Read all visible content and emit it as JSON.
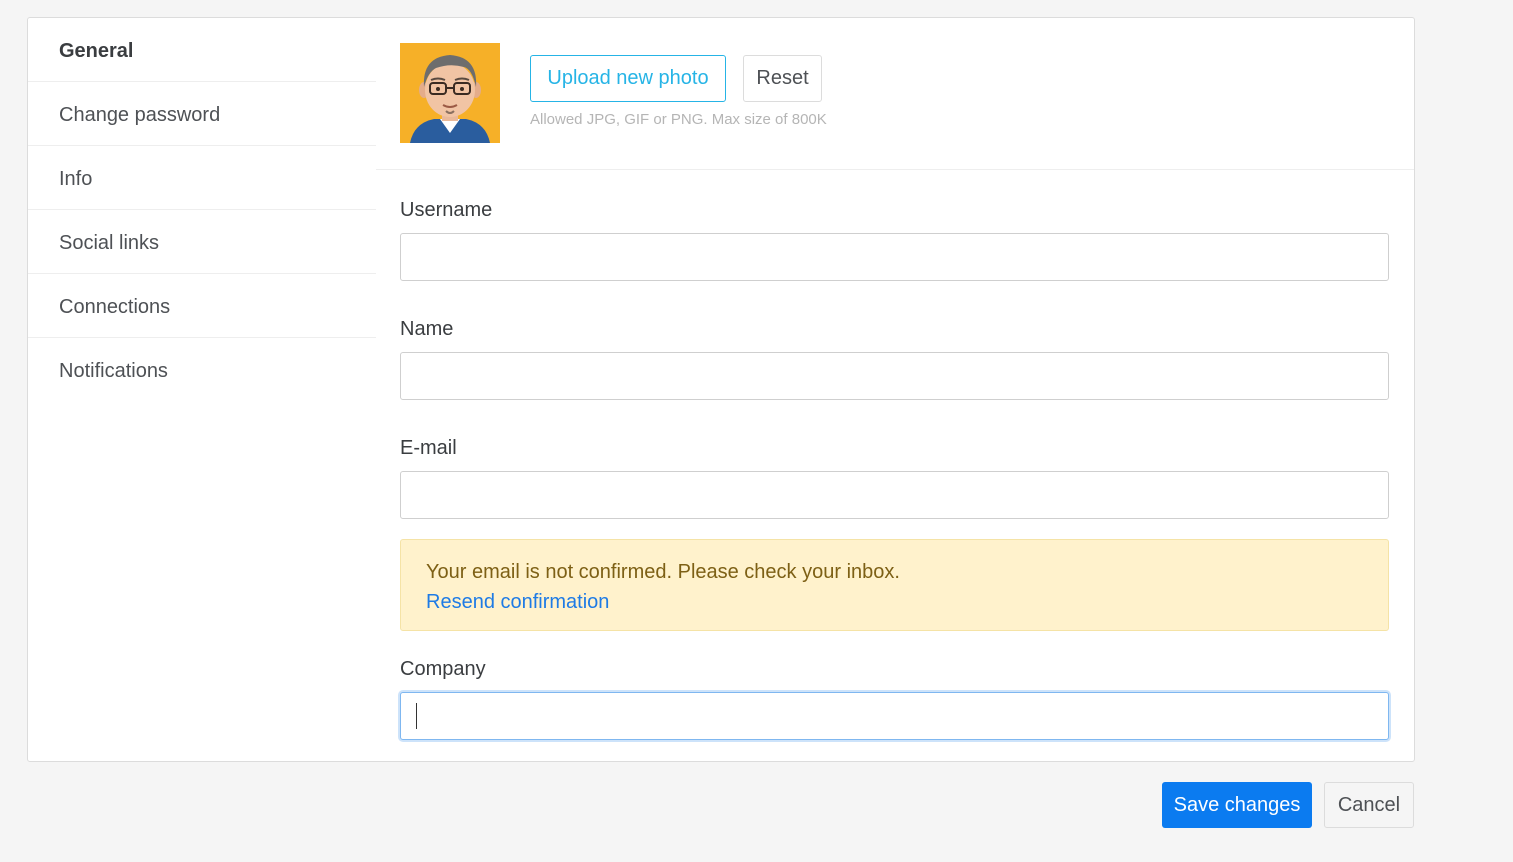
{
  "sidebar": {
    "items": [
      {
        "label": "General"
      },
      {
        "label": "Change password"
      },
      {
        "label": "Info"
      },
      {
        "label": "Social links"
      },
      {
        "label": "Connections"
      },
      {
        "label": "Notifications"
      }
    ]
  },
  "photo": {
    "upload_label": "Upload new photo",
    "reset_label": "Reset",
    "hint": "Allowed JPG, GIF or PNG. Max size of 800K"
  },
  "form": {
    "username": {
      "label": "Username",
      "value": ""
    },
    "name": {
      "label": "Name",
      "value": ""
    },
    "email": {
      "label": "E-mail",
      "value": ""
    },
    "company": {
      "label": "Company",
      "value": ""
    }
  },
  "alert": {
    "text": "Your email is not confirmed. Please check your inbox.",
    "link": "Resend confirmation"
  },
  "actions": {
    "save_label": "Save changes",
    "cancel_label": "Cancel"
  },
  "colors": {
    "primary": "#0b7bf0",
    "upload_accent": "#26b4e6",
    "alert_bg": "#fff2cc",
    "link": "#1e7be5"
  }
}
